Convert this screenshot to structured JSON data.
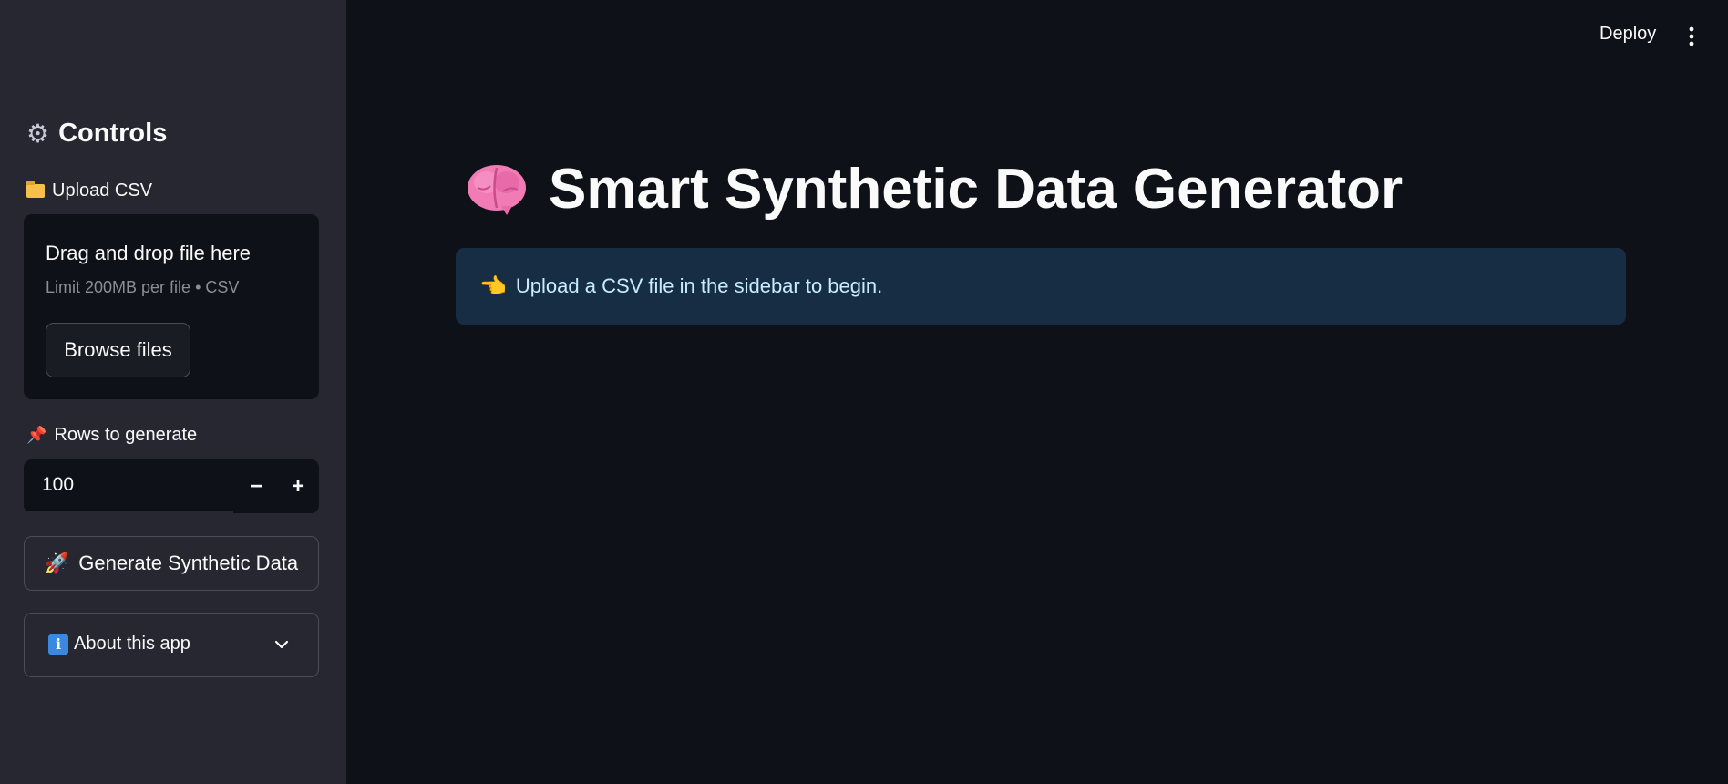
{
  "header": {
    "deploy_label": "Deploy",
    "menu_icon": "kebab-menu-icon"
  },
  "sidebar": {
    "title": "Controls",
    "title_icon": "gear-icon",
    "upload": {
      "label": "Upload CSV",
      "label_icon": "folder-icon",
      "dropzone_title": "Drag and drop file here",
      "dropzone_subtitle": "Limit 200MB per file • CSV",
      "browse_label": "Browse files"
    },
    "rows": {
      "label": "Rows to generate",
      "label_icon": "pushpin-icon",
      "value": "100",
      "minus_label": "−",
      "plus_label": "+"
    },
    "generate_button": {
      "icon": "rocket-icon",
      "label": "Generate Synthetic Data"
    },
    "about": {
      "icon": "info-icon",
      "label": "About this app",
      "chevron": "chevron-down-icon"
    }
  },
  "main": {
    "title_icon": "brain-icon",
    "title": "Smart Synthetic Data Generator",
    "info": {
      "icon": "pointing-hand-icon",
      "text": "Upload a CSV file in the sidebar to begin."
    }
  },
  "colors": {
    "background": "#0e1117",
    "sidebar": "#262730",
    "info_box": "#172d43",
    "info_text": "#c7ebff"
  }
}
